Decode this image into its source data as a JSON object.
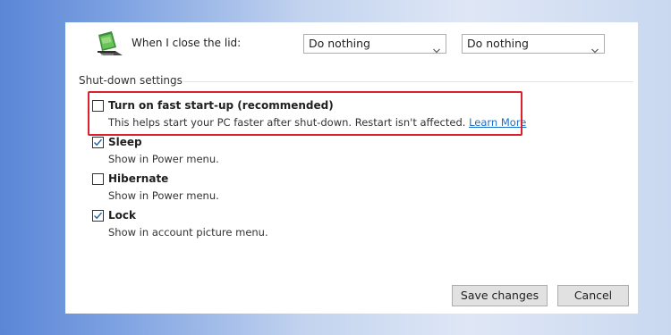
{
  "lid": {
    "label": "When I close the lid:",
    "on_battery_value": "Do nothing",
    "plugged_in_value": "Do nothing"
  },
  "shutdown": {
    "section_title": "Shut-down settings",
    "options": [
      {
        "label": "Turn on fast start-up (recommended)",
        "description": "This helps start your PC faster after shut-down. Restart isn't affected.",
        "link": "Learn More",
        "checked": false
      },
      {
        "label": "Sleep",
        "description": "Show in Power menu.",
        "checked": true
      },
      {
        "label": "Hibernate",
        "description": "Show in Power menu.",
        "checked": false
      },
      {
        "label": "Lock",
        "description": "Show in account picture menu.",
        "checked": true
      }
    ]
  },
  "buttons": {
    "save": "Save changes",
    "cancel": "Cancel"
  },
  "colors": {
    "highlight": "#d9202b",
    "link": "#1a6fc9",
    "accent_check": "#1f5fa8"
  },
  "icons": {
    "lid": "laptop-lid-icon",
    "dropdown": "chevron-down-icon",
    "check": "checkmark-icon"
  }
}
